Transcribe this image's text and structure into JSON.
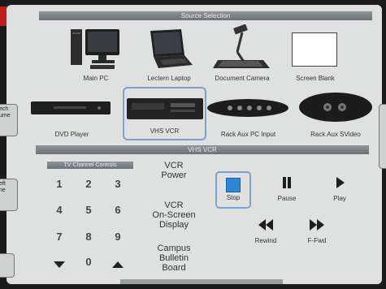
{
  "source_selection": {
    "title": "Source Selection",
    "items": [
      {
        "label": "Main PC",
        "icon": "desktop-pc-icon"
      },
      {
        "label": "Lectern Laptop",
        "icon": "laptop-icon"
      },
      {
        "label": "Document Camera",
        "icon": "document-camera-icon"
      },
      {
        "label": "Screen Blank",
        "icon": "screen-blank-icon"
      },
      {
        "label": "DVD Player",
        "icon": "dvd-player-icon"
      },
      {
        "label": "VHS VCR",
        "icon": "vhs-vcr-icon",
        "selected": true
      },
      {
        "label": "Rack Aux PC Input",
        "icon": "rack-aux-pc-input-icon"
      },
      {
        "label": "Rack Aux SVideo",
        "icon": "rack-aux-svideo-icon"
      }
    ]
  },
  "vhs_section": {
    "title": "VHS VCR"
  },
  "tv_controls": {
    "title": "TV Channel Controls",
    "keys": [
      "1",
      "2",
      "3",
      "4",
      "5",
      "6",
      "7",
      "8",
      "9",
      "0"
    ]
  },
  "vcr_options": {
    "power": [
      "VCR",
      "Power"
    ],
    "display": [
      "VCR",
      "On-Screen",
      "Display"
    ],
    "bulletin": [
      "Campus",
      "Bulletin",
      "Board"
    ]
  },
  "transport": {
    "stop": "Stop",
    "pause": "Pause",
    "play": "Play",
    "rewind": "Rewind",
    "ffwd": "F-Fwd"
  },
  "side_tabs": {
    "top": [
      "ech",
      "ume"
    ],
    "middle": [
      "eft",
      "ne"
    ]
  },
  "colors": {
    "accent_blue": "#2f86d4",
    "selection_border": "#7ea2cc",
    "panel": "#dfe1e0"
  }
}
